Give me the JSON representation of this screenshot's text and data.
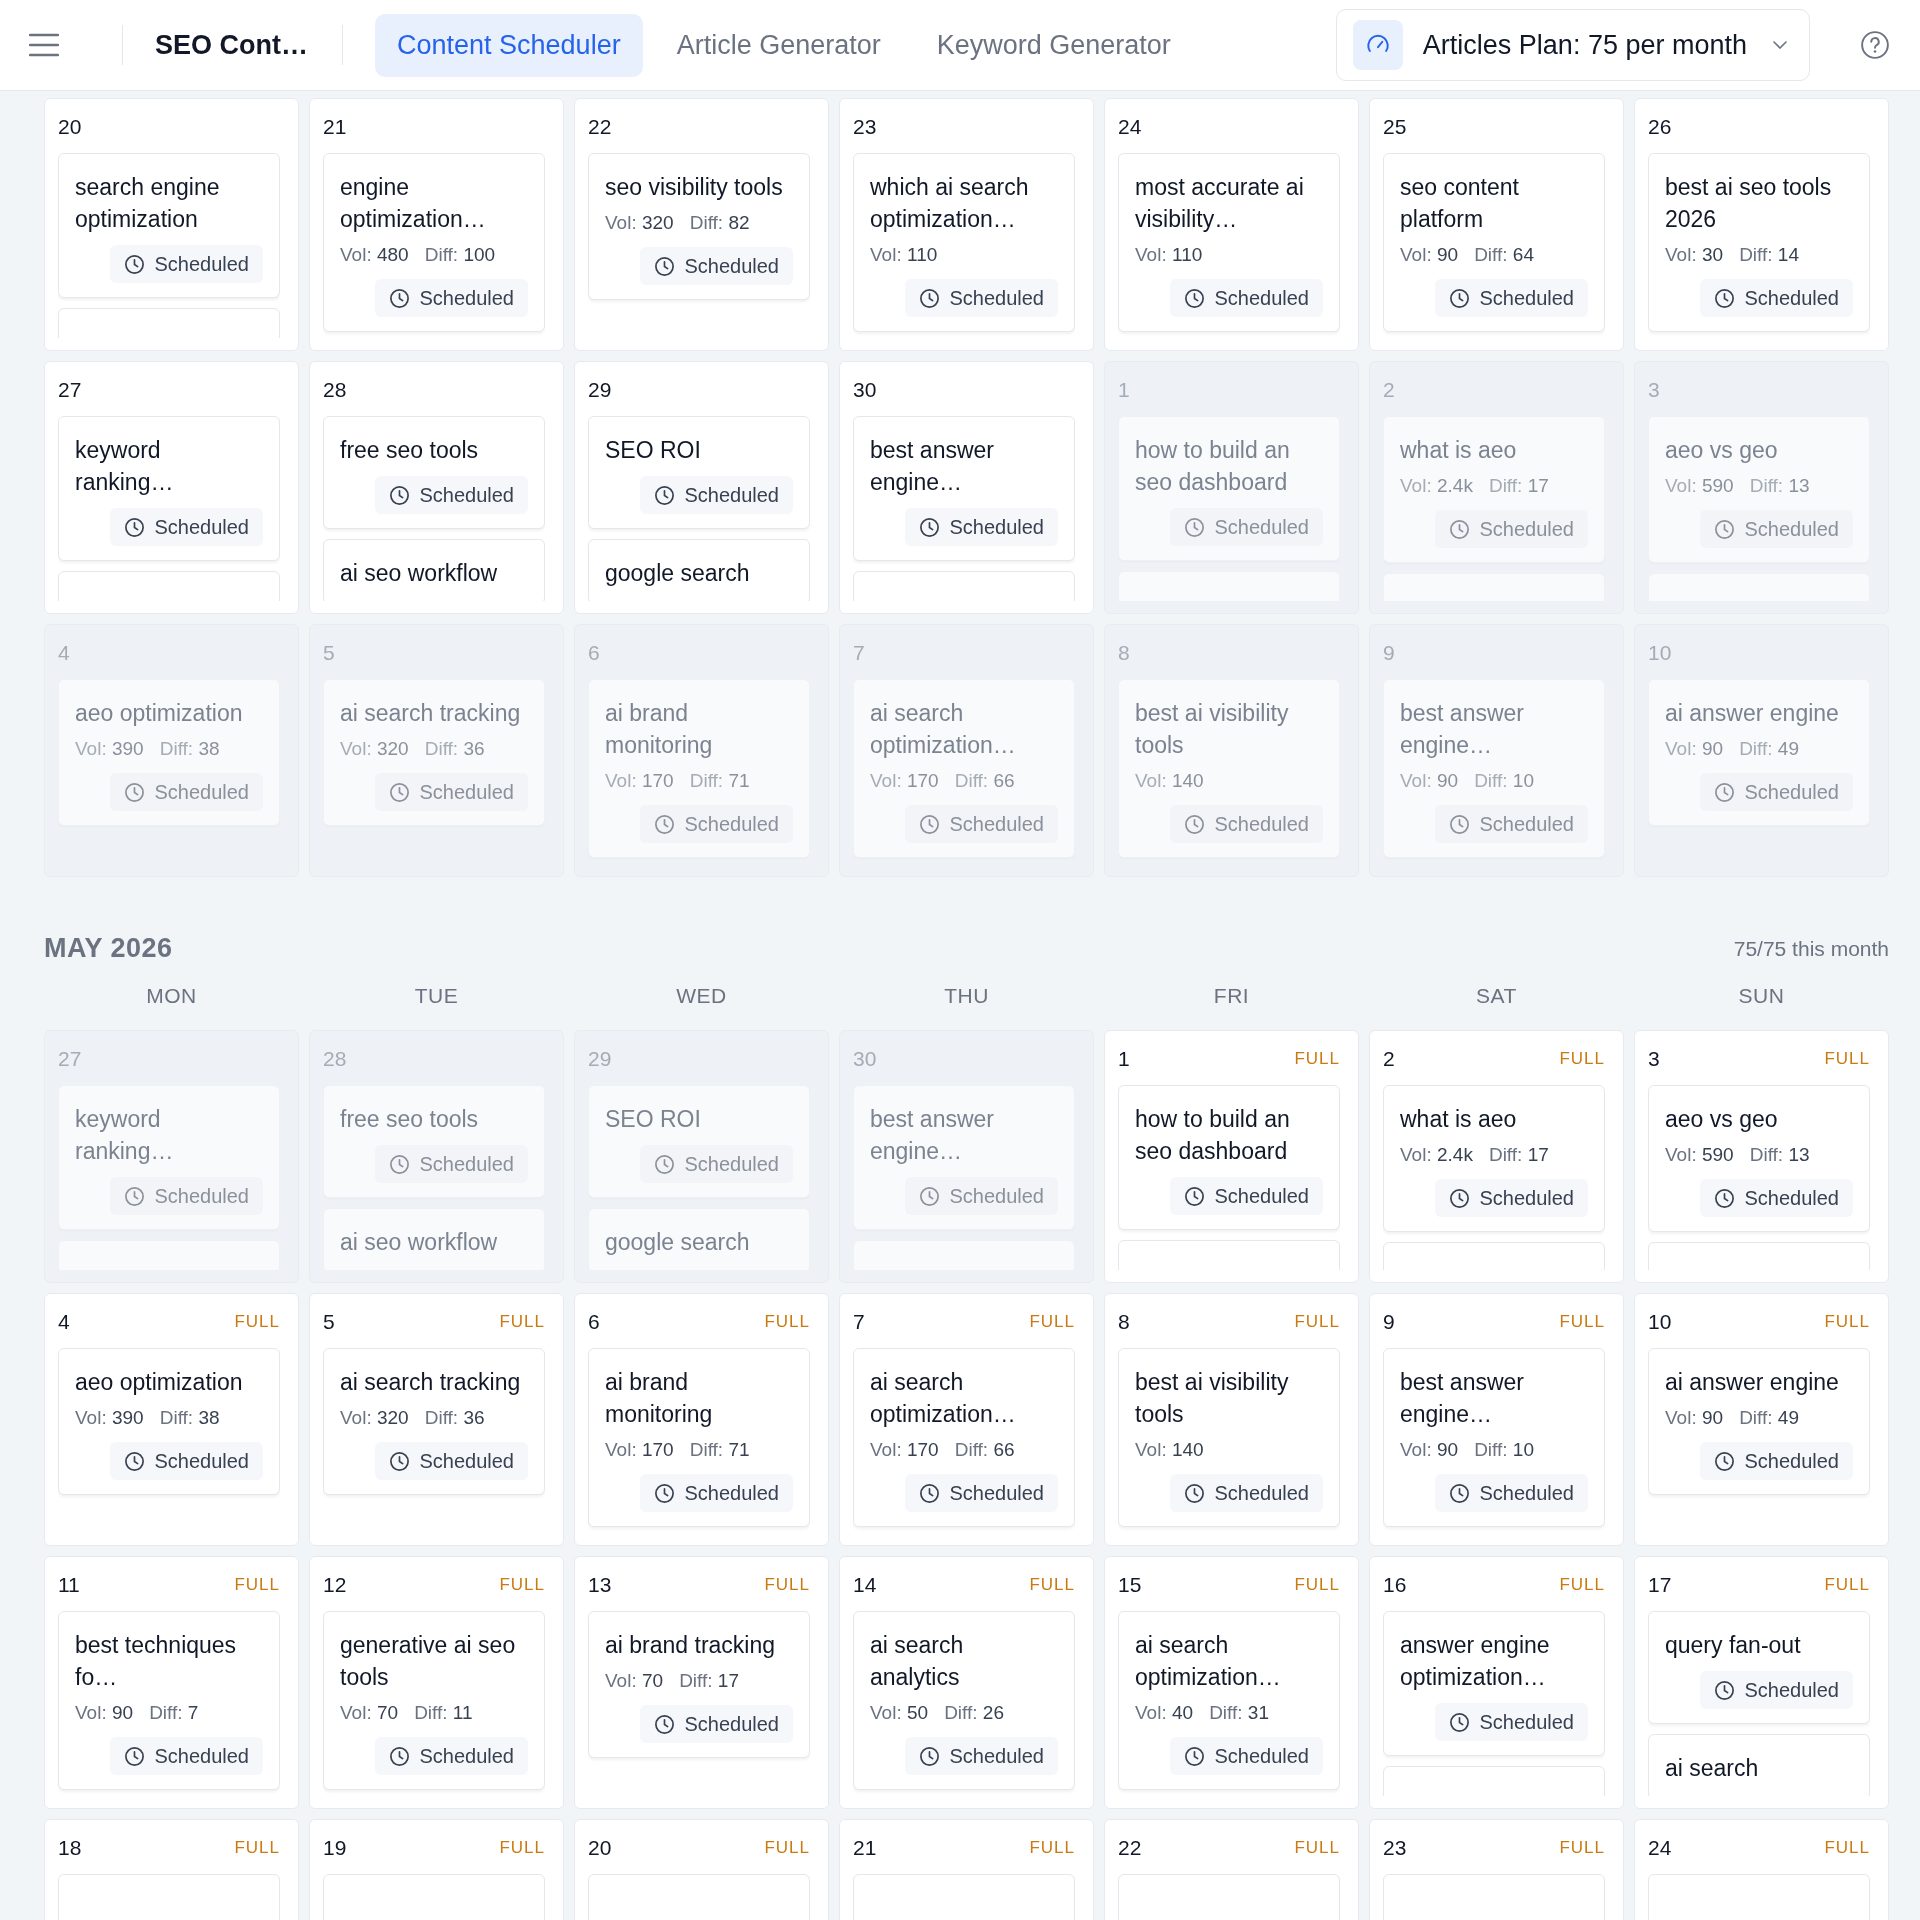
{
  "header": {
    "brand": "SEO Cont…",
    "tabs": [
      {
        "label": "Content Scheduler",
        "selected": true
      },
      {
        "label": "Article Generator",
        "selected": false
      },
      {
        "label": "Keyword Generator",
        "selected": false
      }
    ],
    "plan": {
      "label": "Articles Plan: 75 per month"
    }
  },
  "sections": [
    {
      "weeks": [
        [
          {
            "day": "20",
            "muted": false,
            "cards": [
              {
                "kind": "card",
                "title": "search engine optimization",
                "status": "Scheduled"
              },
              {
                "kind": "stub"
              }
            ]
          },
          {
            "day": "21",
            "muted": false,
            "cards": [
              {
                "kind": "card",
                "title": "engine optimization…",
                "vol": "Vol: **480**",
                "diff": "Diff: **100**",
                "status": "Scheduled"
              }
            ]
          },
          {
            "day": "22",
            "muted": false,
            "cards": [
              {
                "kind": "card",
                "title": "seo visibility tools",
                "vol": "Vol: **320**",
                "diff": "Diff: **82**",
                "status": "Scheduled"
              }
            ]
          },
          {
            "day": "23",
            "muted": false,
            "cards": [
              {
                "kind": "card",
                "title": "which ai search optimization…",
                "vol": "Vol: **110**",
                "status": "Scheduled"
              }
            ]
          },
          {
            "day": "24",
            "muted": false,
            "cards": [
              {
                "kind": "card",
                "title": "most accurate ai visibility…",
                "vol": "Vol: **110**",
                "status": "Scheduled"
              }
            ]
          },
          {
            "day": "25",
            "muted": false,
            "cards": [
              {
                "kind": "card",
                "title": "seo content platform",
                "vol": "Vol: **90**",
                "diff": "Diff: **64**",
                "status": "Scheduled"
              }
            ]
          },
          {
            "day": "26",
            "muted": false,
            "cards": [
              {
                "kind": "card",
                "title": "best ai seo tools 2026",
                "vol": "Vol: **30**",
                "diff": "Diff: **14**",
                "status": "Scheduled"
              }
            ]
          }
        ],
        [
          {
            "day": "27",
            "muted": false,
            "cards": [
              {
                "kind": "card",
                "title": "keyword ranking…",
                "status": "Scheduled"
              },
              {
                "kind": "stub"
              }
            ]
          },
          {
            "day": "28",
            "muted": false,
            "cards": [
              {
                "kind": "card",
                "title": "free seo tools",
                "status": "Scheduled"
              },
              {
                "kind": "peek",
                "title": "ai seo workflow"
              }
            ]
          },
          {
            "day": "29",
            "muted": false,
            "cards": [
              {
                "kind": "card",
                "title": "SEO ROI",
                "status": "Scheduled"
              },
              {
                "kind": "peek",
                "title": "google search"
              }
            ]
          },
          {
            "day": "30",
            "muted": false,
            "cards": [
              {
                "kind": "card",
                "title": "best answer engine…",
                "status": "Scheduled"
              },
              {
                "kind": "stub"
              }
            ]
          },
          {
            "day": "1",
            "muted": true,
            "cards": [
              {
                "kind": "card",
                "title": "how to build an seo dashboard",
                "status": "Scheduled"
              },
              {
                "kind": "stub"
              }
            ]
          },
          {
            "day": "2",
            "muted": true,
            "cards": [
              {
                "kind": "card",
                "title": "what is aeo",
                "vol": "Vol: **2.4k**",
                "diff": "Diff: **17**",
                "status": "Scheduled"
              },
              {
                "kind": "stub"
              }
            ]
          },
          {
            "day": "3",
            "muted": true,
            "cards": [
              {
                "kind": "card",
                "title": "aeo vs geo",
                "vol": "Vol: **590**",
                "diff": "Diff: **13**",
                "status": "Scheduled"
              },
              {
                "kind": "stub"
              }
            ]
          }
        ],
        [
          {
            "day": "4",
            "muted": true,
            "cards": [
              {
                "kind": "card",
                "title": "aeo optimization",
                "vol": "Vol: **390**",
                "diff": "Diff: **38**",
                "status": "Scheduled"
              }
            ]
          },
          {
            "day": "5",
            "muted": true,
            "cards": [
              {
                "kind": "card",
                "title": "ai search tracking",
                "vol": "Vol: **320**",
                "diff": "Diff: **36**",
                "status": "Scheduled"
              }
            ]
          },
          {
            "day": "6",
            "muted": true,
            "cards": [
              {
                "kind": "card",
                "title": "ai brand monitoring",
                "vol": "Vol: **170**",
                "diff": "Diff: **71**",
                "status": "Scheduled"
              }
            ]
          },
          {
            "day": "7",
            "muted": true,
            "cards": [
              {
                "kind": "card",
                "title": "ai search optimization…",
                "vol": "Vol: **170**",
                "diff": "Diff: **66**",
                "status": "Scheduled"
              }
            ]
          },
          {
            "day": "8",
            "muted": true,
            "cards": [
              {
                "kind": "card",
                "title": "best ai visibility tools",
                "vol": "Vol: **140**",
                "status": "Scheduled"
              }
            ]
          },
          {
            "day": "9",
            "muted": true,
            "cards": [
              {
                "kind": "card",
                "title": "best answer engine…",
                "vol": "Vol: **90**",
                "diff": "Diff: **10**",
                "status": "Scheduled"
              }
            ]
          },
          {
            "day": "10",
            "muted": true,
            "cards": [
              {
                "kind": "card",
                "title": "ai answer engine",
                "vol": "Vol: **90**",
                "diff": "Diff: **49**",
                "status": "Scheduled"
              }
            ]
          }
        ]
      ]
    },
    {
      "title": "MAY 2026",
      "summary": "75/75 this month",
      "weekdays": [
        "MON",
        "TUE",
        "WED",
        "THU",
        "FRI",
        "SAT",
        "SUN"
      ],
      "weeks": [
        [
          {
            "day": "27",
            "muted": true,
            "cards": [
              {
                "kind": "card",
                "title": "keyword ranking…",
                "status": "Scheduled"
              },
              {
                "kind": "stub"
              }
            ]
          },
          {
            "day": "28",
            "muted": true,
            "cards": [
              {
                "kind": "card",
                "title": "free seo tools",
                "status": "Scheduled"
              },
              {
                "kind": "peek",
                "title": "ai seo workflow"
              }
            ]
          },
          {
            "day": "29",
            "muted": true,
            "cards": [
              {
                "kind": "card",
                "title": "SEO ROI",
                "status": "Scheduled"
              },
              {
                "kind": "peek",
                "title": "google search"
              }
            ]
          },
          {
            "day": "30",
            "muted": true,
            "cards": [
              {
                "kind": "card",
                "title": "best answer engine…",
                "status": "Scheduled"
              },
              {
                "kind": "stub"
              }
            ]
          },
          {
            "day": "1",
            "muted": false,
            "badge": "FULL",
            "cards": [
              {
                "kind": "card",
                "title": "how to build an seo dashboard",
                "status": "Scheduled"
              },
              {
                "kind": "stub"
              }
            ]
          },
          {
            "day": "2",
            "muted": false,
            "badge": "FULL",
            "cards": [
              {
                "kind": "card",
                "title": "what is aeo",
                "vol": "Vol: **2.4k**",
                "diff": "Diff: **17**",
                "status": "Scheduled"
              },
              {
                "kind": "stub"
              }
            ]
          },
          {
            "day": "3",
            "muted": false,
            "badge": "FULL",
            "cards": [
              {
                "kind": "card",
                "title": "aeo vs geo",
                "vol": "Vol: **590**",
                "diff": "Diff: **13**",
                "status": "Scheduled"
              },
              {
                "kind": "stub"
              }
            ]
          }
        ],
        [
          {
            "day": "4",
            "muted": false,
            "badge": "FULL",
            "cards": [
              {
                "kind": "card",
                "title": "aeo optimization",
                "vol": "Vol: **390**",
                "diff": "Diff: **38**",
                "status": "Scheduled"
              }
            ]
          },
          {
            "day": "5",
            "muted": false,
            "badge": "FULL",
            "cards": [
              {
                "kind": "card",
                "title": "ai search tracking",
                "vol": "Vol: **320**",
                "diff": "Diff: **36**",
                "status": "Scheduled"
              }
            ]
          },
          {
            "day": "6",
            "muted": false,
            "badge": "FULL",
            "cards": [
              {
                "kind": "card",
                "title": "ai brand monitoring",
                "vol": "Vol: **170**",
                "diff": "Diff: **71**",
                "status": "Scheduled"
              }
            ]
          },
          {
            "day": "7",
            "muted": false,
            "badge": "FULL",
            "cards": [
              {
                "kind": "card",
                "title": "ai search optimization…",
                "vol": "Vol: **170**",
                "diff": "Diff: **66**",
                "status": "Scheduled"
              }
            ]
          },
          {
            "day": "8",
            "muted": false,
            "badge": "FULL",
            "cards": [
              {
                "kind": "card",
                "title": "best ai visibility tools",
                "vol": "Vol: **140**",
                "status": "Scheduled"
              }
            ]
          },
          {
            "day": "9",
            "muted": false,
            "badge": "FULL",
            "cards": [
              {
                "kind": "card",
                "title": "best answer engine…",
                "vol": "Vol: **90**",
                "diff": "Diff: **10**",
                "status": "Scheduled"
              }
            ]
          },
          {
            "day": "10",
            "muted": false,
            "badge": "FULL",
            "cards": [
              {
                "kind": "card",
                "title": "ai answer engine",
                "vol": "Vol: **90**",
                "diff": "Diff: **49**",
                "status": "Scheduled"
              }
            ]
          }
        ],
        [
          {
            "day": "11",
            "muted": false,
            "badge": "FULL",
            "cards": [
              {
                "kind": "card",
                "title": "best techniques fo…",
                "vol": "Vol: **90**",
                "diff": "Diff: **7**",
                "status": "Scheduled"
              }
            ]
          },
          {
            "day": "12",
            "muted": false,
            "badge": "FULL",
            "cards": [
              {
                "kind": "card",
                "title": "generative ai seo tools",
                "vol": "Vol: **70**",
                "diff": "Diff: **11**",
                "status": "Scheduled"
              }
            ]
          },
          {
            "day": "13",
            "muted": false,
            "badge": "FULL",
            "cards": [
              {
                "kind": "card",
                "title": "ai brand tracking",
                "vol": "Vol: **70**",
                "diff": "Diff: **17**",
                "status": "Scheduled"
              }
            ]
          },
          {
            "day": "14",
            "muted": false,
            "badge": "FULL",
            "cards": [
              {
                "kind": "card",
                "title": "ai search analytics",
                "vol": "Vol: **50**",
                "diff": "Diff: **26**",
                "status": "Scheduled"
              }
            ]
          },
          {
            "day": "15",
            "muted": false,
            "badge": "FULL",
            "cards": [
              {
                "kind": "card",
                "title": "ai search optimization…",
                "vol": "Vol: **40**",
                "diff": "Diff: **31**",
                "status": "Scheduled"
              }
            ]
          },
          {
            "day": "16",
            "muted": false,
            "badge": "FULL",
            "cards": [
              {
                "kind": "card",
                "title": "answer engine optimization…",
                "status": "Scheduled"
              },
              {
                "kind": "stub"
              }
            ]
          },
          {
            "day": "17",
            "muted": false,
            "badge": "FULL",
            "cards": [
              {
                "kind": "card",
                "title": "query fan-out",
                "status": "Scheduled"
              },
              {
                "kind": "peek",
                "title": "ai search"
              }
            ]
          }
        ],
        [
          {
            "day": "18",
            "muted": false,
            "badge": "FULL",
            "cards": [
              {
                "kind": "stub"
              }
            ]
          },
          {
            "day": "19",
            "muted": false,
            "badge": "FULL",
            "cards": [
              {
                "kind": "stub"
              }
            ]
          },
          {
            "day": "20",
            "muted": false,
            "badge": "FULL",
            "cards": [
              {
                "kind": "stub"
              }
            ]
          },
          {
            "day": "21",
            "muted": false,
            "badge": "FULL",
            "cards": [
              {
                "kind": "stub"
              }
            ]
          },
          {
            "day": "22",
            "muted": false,
            "badge": "FULL",
            "cards": [
              {
                "kind": "stub"
              }
            ]
          },
          {
            "day": "23",
            "muted": false,
            "badge": "FULL",
            "cards": [
              {
                "kind": "stub"
              }
            ]
          },
          {
            "day": "24",
            "muted": false,
            "badge": "FULL",
            "cards": [
              {
                "kind": "stub"
              }
            ]
          }
        ]
      ]
    }
  ]
}
